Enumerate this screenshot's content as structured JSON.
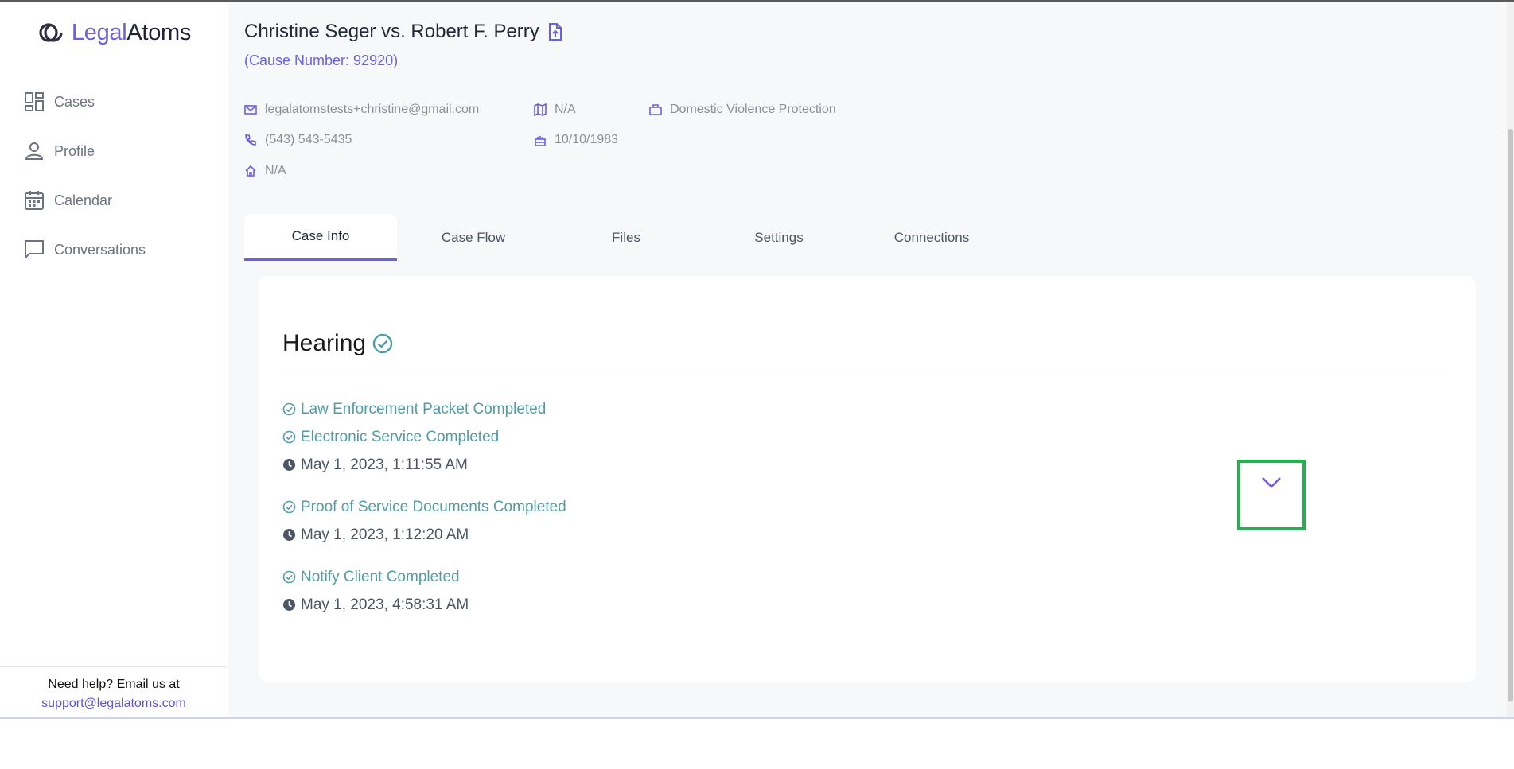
{
  "logo": {
    "part1": "Legal",
    "part2": "Atoms"
  },
  "sidebar": {
    "items": [
      {
        "label": "Cases",
        "icon": "dashboard-icon"
      },
      {
        "label": "Profile",
        "icon": "person-icon"
      },
      {
        "label": "Calendar",
        "icon": "calendar-icon"
      },
      {
        "label": "Conversations",
        "icon": "chat-icon"
      }
    ],
    "help_text": "Need help? Email us at",
    "help_email": "support@legalatoms.com"
  },
  "case": {
    "title": "Christine Seger vs. Robert F. Perry",
    "cause_number": "(Cause Number: 92920)",
    "email": "legalatomstests+christine@gmail.com",
    "phone": "(543) 543-5435",
    "address": "N/A",
    "map": "N/A",
    "dob": "10/10/1983",
    "case_type": "Domestic Violence Protection"
  },
  "tabs": [
    "Case Info",
    "Case Flow",
    "Files",
    "Settings",
    "Connections"
  ],
  "hearing": {
    "title": "Hearing",
    "events": [
      {
        "items": [
          "Law Enforcement Packet Completed",
          "Electronic Service Completed"
        ],
        "time": "May 1, 2023, 1:11:55 AM"
      },
      {
        "items": [
          "Proof of Service Documents Completed"
        ],
        "time": "May 1, 2023, 1:12:20 AM"
      },
      {
        "items": [
          "Notify Client Completed"
        ],
        "time": "May 1, 2023, 4:58:31 AM"
      }
    ]
  },
  "colors": {
    "accent": "#6b5fe3",
    "completed": "#4f9ea5",
    "highlight": "#22b14c"
  }
}
